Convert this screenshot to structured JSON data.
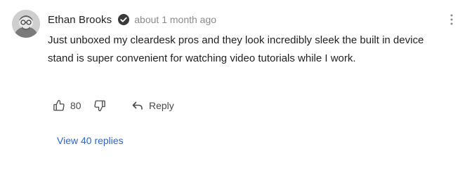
{
  "comment": {
    "author": "Ethan Brooks",
    "timestamp": "about 1 month ago",
    "text": "Just unboxed my cleardesk pros and they look incredibly sleek the built in device stand is super convenient for watching video tutorials while I work.",
    "like_count": "80",
    "reply_label": "Reply",
    "view_replies_label": "View 40 replies"
  },
  "icons": {
    "avatar": "user-avatar-icon",
    "verified": "verified-check-icon",
    "more": "more-vertical-icon",
    "like": "thumbs-up-icon",
    "dislike": "thumbs-down-icon",
    "reply": "reply-arrow-icon"
  },
  "colors": {
    "accent_link": "#2a66d0",
    "muted_text": "#8a8a8a",
    "verified_badge": "#3a3a3a"
  }
}
